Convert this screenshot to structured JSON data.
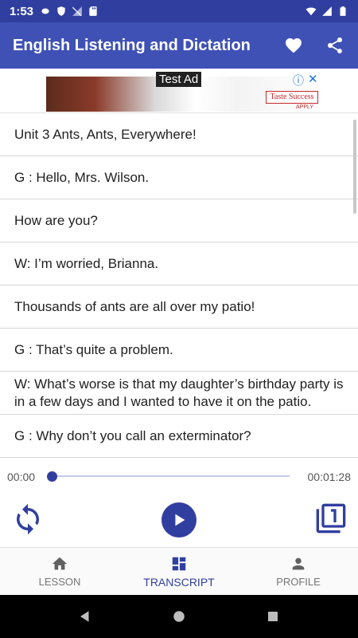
{
  "status_bar": {
    "time": "1:53"
  },
  "app_bar": {
    "title": "English Listening and Dictation"
  },
  "ad": {
    "label": "Test Ad",
    "brand": "Taste Success",
    "apply": "APPLY"
  },
  "transcript": [
    "Unit 3 Ants, Ants, Everywhere!",
    "G : Hello, Mrs. Wilson.",
    "How are you?",
    "W: I’m worried, Brianna.",
    "Thousands of ants are all over my patio!",
    "G : That’s quite a problem.",
    "W: What’s worse is that my daughter’s birthday party is in a few days and I wanted to have it on the patio.",
    "G : Why don’t you call an exterminator?"
  ],
  "player": {
    "current_time": "00:00",
    "total_time": "00:01:28",
    "progress": 0
  },
  "bottom_nav": [
    {
      "label": "LESSON",
      "icon": "home-icon",
      "active": false
    },
    {
      "label": "TRANSCRIPT",
      "icon": "dashboard-icon",
      "active": true
    },
    {
      "label": "PROFILE",
      "icon": "person-icon",
      "active": false
    }
  ],
  "colors": {
    "primary": "#3F51B5",
    "primary_dark": "#303F9F",
    "accent": "#303F9F"
  }
}
